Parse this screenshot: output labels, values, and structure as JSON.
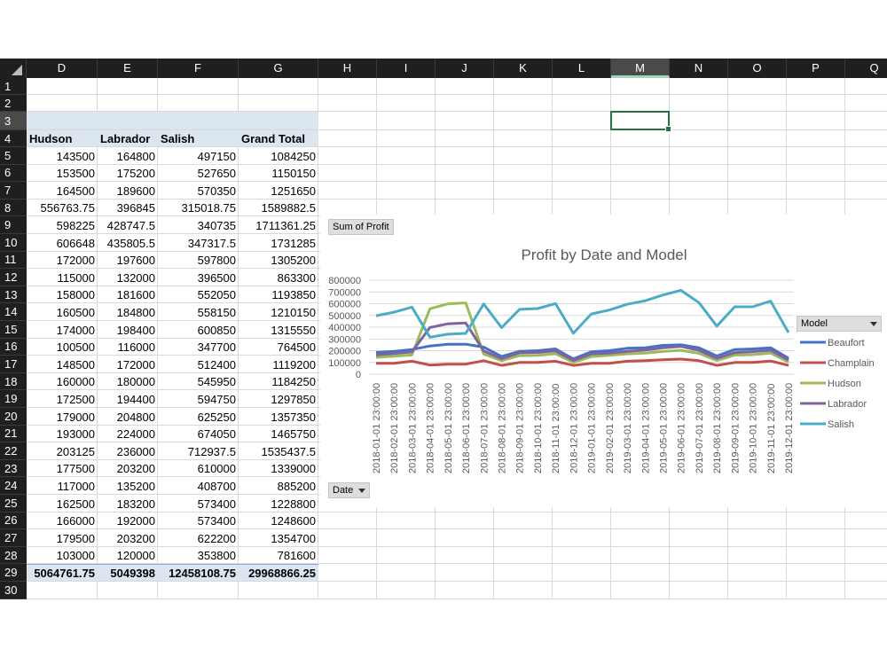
{
  "columns": [
    "D",
    "E",
    "F",
    "G",
    "H",
    "I",
    "J",
    "K",
    "L",
    "M",
    "N",
    "O",
    "P",
    "Q"
  ],
  "selected_column": "M",
  "rows": [
    "1",
    "2",
    "3",
    "4",
    "5",
    "6",
    "7",
    "8",
    "9",
    "10",
    "11",
    "12",
    "13",
    "14",
    "15",
    "16",
    "17",
    "18",
    "19",
    "20",
    "21",
    "22",
    "23",
    "24",
    "25",
    "26",
    "27",
    "28",
    "29",
    "30"
  ],
  "selected_row": "3",
  "pivot": {
    "headers": [
      "Hudson",
      "Labrador",
      "Salish",
      "Grand Total"
    ],
    "data": [
      [
        "143500",
        "164800",
        "497150",
        "1084250"
      ],
      [
        "153500",
        "175200",
        "527650",
        "1150150"
      ],
      [
        "164500",
        "189600",
        "570350",
        "1251650"
      ],
      [
        "556763.75",
        "396845",
        "315018.75",
        "1589882.5"
      ],
      [
        "598225",
        "428747.5",
        "340735",
        "1711361.25"
      ],
      [
        "606648",
        "435805.5",
        "347317.5",
        "1731285"
      ],
      [
        "172000",
        "197600",
        "597800",
        "1305200"
      ],
      [
        "115000",
        "132000",
        "396500",
        "863300"
      ],
      [
        "158000",
        "181600",
        "552050",
        "1193850"
      ],
      [
        "160500",
        "184800",
        "558150",
        "1210150"
      ],
      [
        "174000",
        "198400",
        "600850",
        "1315550"
      ],
      [
        "100500",
        "116000",
        "347700",
        "764500"
      ],
      [
        "148500",
        "172000",
        "512400",
        "1119200"
      ],
      [
        "160000",
        "180000",
        "545950",
        "1184250"
      ],
      [
        "172500",
        "194400",
        "594750",
        "1297850"
      ],
      [
        "179000",
        "204800",
        "625250",
        "1357350"
      ],
      [
        "193000",
        "224000",
        "674050",
        "1465750"
      ],
      [
        "203125",
        "236000",
        "712937.5",
        "1535437.5"
      ],
      [
        "177500",
        "203200",
        "610000",
        "1339000"
      ],
      [
        "117000",
        "135200",
        "408700",
        "885200"
      ],
      [
        "162500",
        "183200",
        "573400",
        "1228800"
      ],
      [
        "166000",
        "192000",
        "573400",
        "1248600"
      ],
      [
        "179500",
        "203200",
        "622200",
        "1354700"
      ],
      [
        "103000",
        "120000",
        "353800",
        "781600"
      ]
    ],
    "totals": [
      "5064761.75",
      "5049398",
      "12458108.75",
      "29968866.25"
    ]
  },
  "chart": {
    "value_button": "Sum of Profit",
    "axis_button": "Date",
    "legend_button": "Model",
    "dropdown_icon": "dropdown-arrow-icon"
  },
  "chart_data": {
    "type": "line",
    "title": "Profit by Date and Model",
    "ylim": [
      0,
      800000
    ],
    "yticks": [
      "0",
      "100000",
      "200000",
      "300000",
      "400000",
      "500000",
      "600000",
      "700000",
      "800000"
    ],
    "grid": true,
    "legend_placement": "right",
    "x": [
      "2018-01-01 23:00:00",
      "2018-02-01 23:00:00",
      "2018-03-01 23:00:00",
      "2018-04-01 23:00:00",
      "2018-05-01 23:00:00",
      "2018-06-01 23:00:00",
      "2018-07-01 23:00:00",
      "2018-08-01 23:00:00",
      "2018-09-01 23:00:00",
      "2018-10-01 23:00:00",
      "2018-11-01 23:00:00",
      "2018-12-01 23:00:00",
      "2019-01-01 23:00:00",
      "2019-02-01 23:00:00",
      "2019-03-01 23:00:00",
      "2019-04-01 23:00:00",
      "2019-05-01 23:00:00",
      "2019-06-01 23:00:00",
      "2019-07-01 23:00:00",
      "2019-08-01 23:00:00",
      "2019-09-01 23:00:00",
      "2019-10-01 23:00:00",
      "2019-11-01 23:00:00",
      "2019-12-01 23:00:00"
    ],
    "series": [
      {
        "name": "Beaufort",
        "color": "#4472c4",
        "values": [
          185000,
          195000,
          210000,
          240000,
          255000,
          255000,
          230000,
          150000,
          195000,
          200000,
          215000,
          130000,
          190000,
          200000,
          220000,
          225000,
          245000,
          250000,
          225000,
          155000,
          210000,
          215000,
          225000,
          135000
        ]
      },
      {
        "name": "Champlain",
        "color": "#c0504d",
        "values": [
          93000,
          93000,
          110000,
          78000,
          85000,
          85000,
          115000,
          75000,
          100000,
          100000,
          110000,
          75000,
          93000,
          93000,
          110000,
          115000,
          122000,
          128000,
          115000,
          75000,
          100000,
          100000,
          112000,
          75000
        ]
      },
      {
        "name": "Hudson",
        "color": "#9bbb59",
        "values": [
          143500,
          153500,
          164500,
          556763.75,
          598225,
          606648,
          172000,
          115000,
          158000,
          160500,
          174000,
          100500,
          148500,
          160000,
          172500,
          179000,
          193000,
          203125,
          177500,
          117000,
          162500,
          166000,
          179500,
          103000
        ]
      },
      {
        "name": "Labrador",
        "color": "#8064a2",
        "values": [
          164800,
          175200,
          189600,
          396845,
          428747.5,
          435805.5,
          197600,
          132000,
          181600,
          184800,
          198400,
          116000,
          172000,
          180000,
          194400,
          204800,
          224000,
          236000,
          203200,
          135200,
          183200,
          192000,
          203200,
          120000
        ]
      },
      {
        "name": "Salish",
        "color": "#4bacc6",
        "values": [
          497150,
          527650,
          570350,
          315018.75,
          340735,
          347317.5,
          597800,
          396500,
          552050,
          558150,
          600850,
          347700,
          512400,
          545950,
          594750,
          625250,
          674050,
          712937.5,
          610000,
          408700,
          573400,
          573400,
          622200,
          353800
        ]
      }
    ]
  }
}
